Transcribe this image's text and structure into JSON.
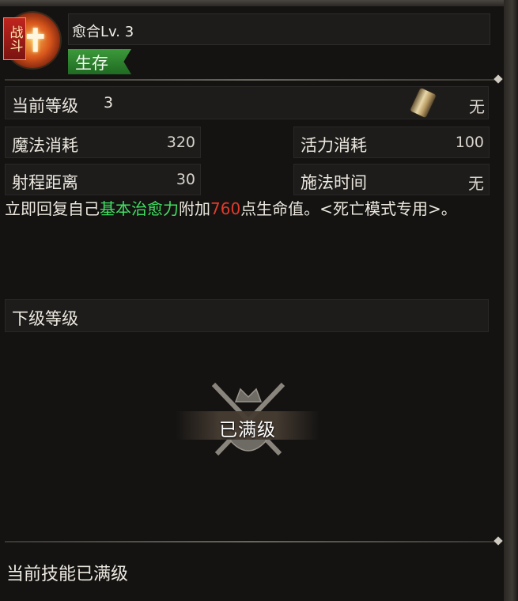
{
  "header": {
    "battle_tag": "战斗",
    "skill_name": "愈合",
    "skill_level": "Lv. 3",
    "category": "生存"
  },
  "current": {
    "label": "当前等级",
    "level": "3",
    "reagent": "无",
    "reagent_icon": "scroll-icon"
  },
  "stats": {
    "mana_label": "魔法消耗",
    "mana_value": "320",
    "vigor_label": "活力消耗",
    "vigor_value": "100",
    "range_label": "射程距离",
    "range_value": "30",
    "cast_label": "施法时间",
    "cast_value": "无"
  },
  "description": {
    "part1": "立即回复自己",
    "highlight": "基本治愈力",
    "part2": "附加",
    "amount": "760",
    "part3": "点生命值。<死亡模式专用>。",
    "highlight_color": "#3fe060",
    "amount_color": "#e03a2a"
  },
  "next": {
    "label": "下级等级"
  },
  "max_badge": {
    "text": "已满级",
    "icon": "crown-crossed-swords-shield-icon"
  },
  "footer": {
    "status": "当前技能已满级"
  }
}
